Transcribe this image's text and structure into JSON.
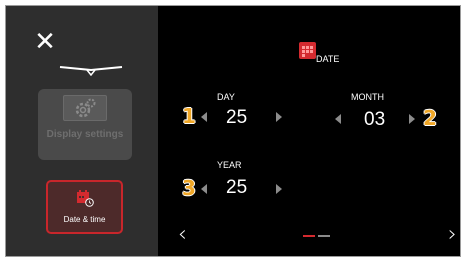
{
  "sidebar": {
    "display_settings_label": "Display settings",
    "date_time_label": "Date & time"
  },
  "main": {
    "title": "DATE",
    "day": {
      "label": "DAY",
      "value": "25",
      "badge": "1"
    },
    "month": {
      "label": "MONTH",
      "value": "03",
      "badge": "2"
    },
    "year": {
      "label": "YEAR",
      "value": "25",
      "badge": "3"
    },
    "pagination": {
      "current": 1,
      "total": 2
    }
  },
  "colors": {
    "accent": "#d42a2f",
    "badge": "#f0a726",
    "sidebar_bg": "#2e2e2e",
    "background": "#000000"
  },
  "icons": {
    "close": "close-icon",
    "display": "gear-icon",
    "date": "calendar-clock-icon",
    "prev": "chevron-left-icon",
    "next": "chevron-right-icon"
  }
}
